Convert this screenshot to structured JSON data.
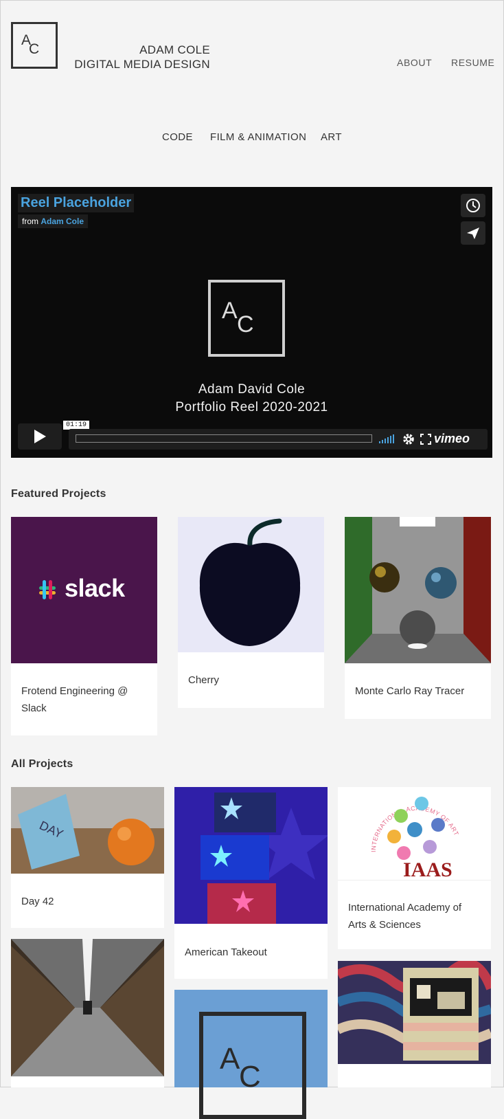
{
  "header": {
    "logo": {
      "a": "A",
      "c": "C"
    },
    "brand_line1": "ADAM COLE",
    "brand_line2": "DIGITAL MEDIA DESIGN",
    "nav": [
      "ABOUT",
      "RESUME"
    ]
  },
  "categories": [
    "CODE",
    "FILM & ANIMATION",
    "ART"
  ],
  "video": {
    "title": "Reel Placeholder",
    "from_prefix": "from",
    "from_author": "Adam Cole",
    "logo": {
      "a": "A",
      "c": "C"
    },
    "caption_line1": "Adam David Cole",
    "caption_line2": "Portfolio Reel 2020-2021",
    "time": "01:19",
    "brand": "vimeo",
    "progress": 0
  },
  "featured": {
    "heading": "Featured Projects",
    "items": [
      {
        "label_line1": "Frotend Engineering @",
        "label_line2": "Slack",
        "thumb_text": "slack"
      },
      {
        "label_line1": "Cherry",
        "label_line2": ""
      },
      {
        "label_line1": "Monte Carlo Ray Tracer",
        "label_line2": ""
      }
    ]
  },
  "all": {
    "heading": "All Projects",
    "items": [
      {
        "label_line1": "Day 42",
        "label_line2": ""
      },
      {
        "label_line1": "American Takeout",
        "label_line2": ""
      },
      {
        "label_line1": "International Academy of",
        "label_line2": "Arts & Sciences",
        "thumb_text": "IAAS",
        "thumb_arc": "INTERNATIONAL ACADEMY OF ARTS AND SCIENCES"
      }
    ],
    "ac_logo": {
      "a": "A",
      "c": "C"
    }
  },
  "colors": {
    "accent": "#4aa3df",
    "slack_bg": "#4a154b",
    "iaas_red": "#9b1c1c"
  }
}
